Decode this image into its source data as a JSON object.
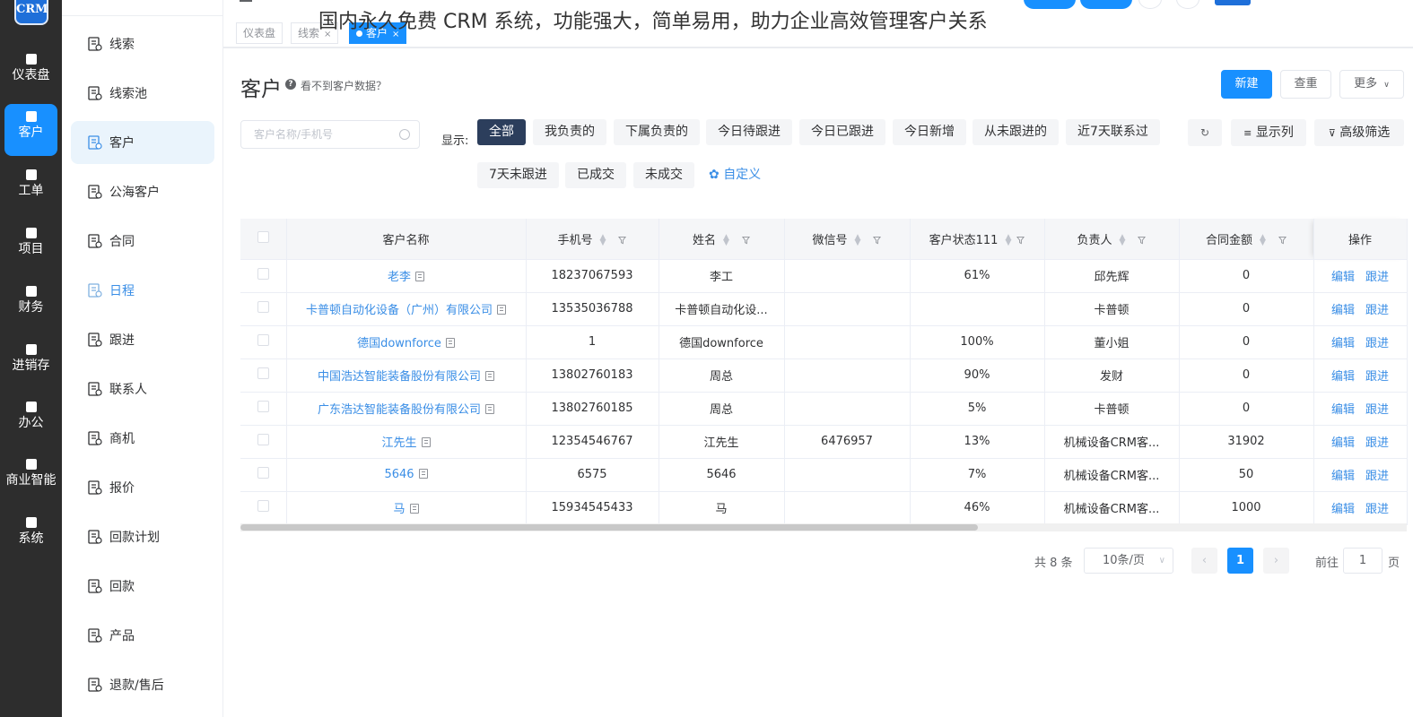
{
  "overlay_title": "国内永久免费 CRM 系统，功能强大，简单易用，助力企业高效管理客户关系",
  "logo": {
    "text": "CRM"
  },
  "rail": [
    {
      "label": "仪表盘",
      "icon": "home-icon"
    },
    {
      "label": "客户",
      "icon": "user-group-icon",
      "active": true
    },
    {
      "label": "工单",
      "icon": "clipboard-icon"
    },
    {
      "label": "项目",
      "icon": "books-icon"
    },
    {
      "label": "财务",
      "icon": "finance-icon"
    },
    {
      "label": "进销存",
      "icon": "warehouse-icon"
    },
    {
      "label": "办公",
      "icon": "office-icon"
    },
    {
      "label": "商业智能",
      "icon": "bar-chart-icon"
    },
    {
      "label": "系统",
      "icon": "system-icon"
    }
  ],
  "subnav": [
    {
      "label": "线索",
      "icon": "lead-icon"
    },
    {
      "label": "线索池",
      "icon": "lead-pool-icon"
    },
    {
      "label": "客户",
      "icon": "customer-icon",
      "active": true
    },
    {
      "label": "公海客户",
      "icon": "public-customer-icon"
    },
    {
      "label": "合同",
      "icon": "contract-icon"
    },
    {
      "label": "日程",
      "icon": "schedule-icon"
    },
    {
      "label": "跟进",
      "icon": "followup-icon"
    },
    {
      "label": "联系人",
      "icon": "contact-icon"
    },
    {
      "label": "商机",
      "icon": "opportunity-icon"
    },
    {
      "label": "报价",
      "icon": "quote-icon"
    },
    {
      "label": "回款计划",
      "icon": "payment-plan-icon"
    },
    {
      "label": "回款",
      "icon": "payment-icon"
    },
    {
      "label": "产品",
      "icon": "product-icon"
    },
    {
      "label": "退款/售后",
      "icon": "refund-icon"
    }
  ],
  "tags": [
    {
      "label": "仪表盘",
      "closable": false
    },
    {
      "label": "线索",
      "closable": true
    },
    {
      "label": "客户",
      "closable": true,
      "active": true
    }
  ],
  "page": {
    "title": "客户",
    "help_link": "看不到客户数据？",
    "new_button": "新建",
    "dedupe_button": "查重",
    "more_button": "更多"
  },
  "filter": {
    "search_placeholder": "客户名称/手机号",
    "show_label": "显示:",
    "chips": [
      "全部",
      "我负责的",
      "下属负责的",
      "今日待跟进",
      "今日已跟进",
      "今日新增",
      "从未跟进的",
      "近7天联系过",
      "7天未跟进",
      "已成交",
      "未成交"
    ],
    "active_chip": "全部",
    "custom_label": "自定义",
    "columns_button": "显示列",
    "advanced_filter_button": "高级筛选"
  },
  "table": {
    "columns": [
      "客户名称",
      "手机号",
      "姓名",
      "微信号",
      "客户状态111",
      "负责人",
      "合同金额",
      "操作"
    ],
    "edit_label": "编辑",
    "follow_label": "跟进",
    "rows": [
      {
        "name": "老李",
        "phone": "18237067593",
        "contact": "李工",
        "wechat": "",
        "status": "61%",
        "owner": "邱先辉",
        "amount": "0"
      },
      {
        "name": "卡普顿自动化设备（广州）有限公司",
        "phone": "13535036788",
        "contact": "卡普顿自动化设...",
        "wechat": "",
        "status": "",
        "owner": "卡普顿",
        "amount": "0"
      },
      {
        "name": "德国downforce",
        "phone": "1",
        "contact": "德国downforce",
        "wechat": "",
        "status": "100%",
        "owner": "董小姐",
        "amount": "0"
      },
      {
        "name": "中国浩达智能装备股份有限公司",
        "phone": "13802760183",
        "contact": "周总",
        "wechat": "",
        "status": "90%",
        "owner": "发财",
        "amount": "0"
      },
      {
        "name": "广东浩达智能装备股份有限公司",
        "phone": "13802760185",
        "contact": "周总",
        "wechat": "",
        "status": "5%",
        "owner": "卡普顿",
        "amount": "0"
      },
      {
        "name": "江先生",
        "phone": "12354546767",
        "contact": "江先生",
        "wechat": "6476957",
        "status": "13%",
        "owner": "机械设备CRM客...",
        "amount": "31902"
      },
      {
        "name": "5646",
        "phone": "6575",
        "contact": "5646",
        "wechat": "",
        "status": "7%",
        "owner": "机械设备CRM客...",
        "amount": "50"
      },
      {
        "name": "马",
        "phone": "15934545433",
        "contact": "马",
        "wechat": "",
        "status": "46%",
        "owner": "机械设备CRM客...",
        "amount": "1000"
      }
    ]
  },
  "pagination": {
    "total_text": "共 8 条",
    "page_size": "10条/页",
    "current_page": "1",
    "goto_label": "前往",
    "goto_value": "1",
    "page_suffix": "页"
  },
  "colors": {
    "primary": "#1890ff",
    "link": "#3a8ee6",
    "rail_bg": "#2d2d2d",
    "chip_active": "#2c3e5c"
  }
}
